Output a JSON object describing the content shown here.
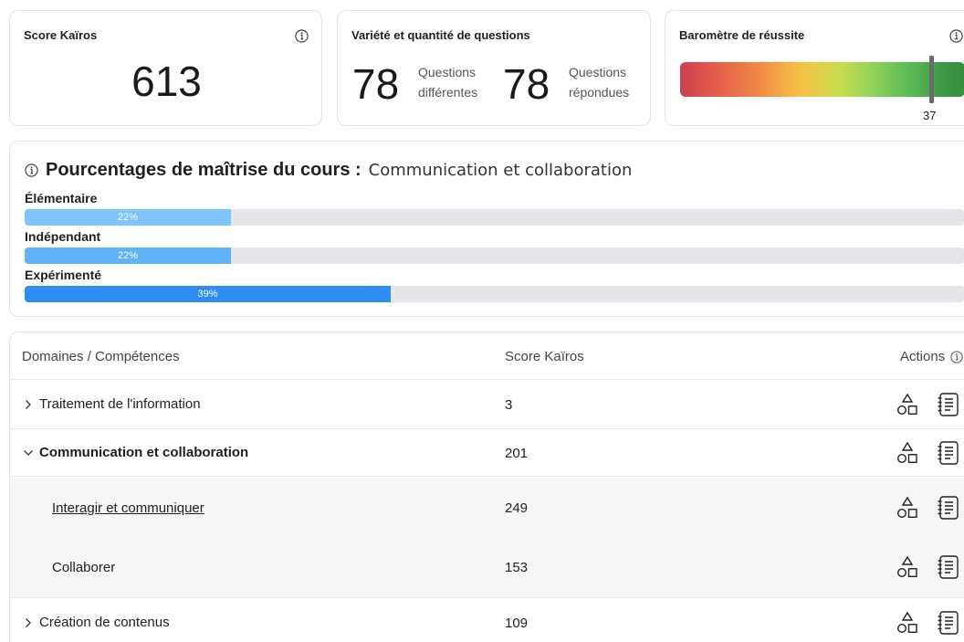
{
  "score_card": {
    "title": "Score Kaïros",
    "value": "613",
    "info_icon": "info-icon"
  },
  "variety_card": {
    "title": "Variété et quantité de questions",
    "different_count": "78",
    "different_label_1": "Questions",
    "different_label_2": "différentes",
    "answered_count": "78",
    "answered_label_1": "Questions",
    "answered_label_2": "répondues"
  },
  "barometer_card": {
    "title": "Baromètre de réussite",
    "value": "37",
    "marker_fraction": 0.88
  },
  "mastery": {
    "title_bold": "Pourcentages de maîtrise du cours :",
    "course_name": "Communication et collaboration",
    "levels": [
      {
        "label": "Élémentaire",
        "percent_label": "22%",
        "fraction": 0.22,
        "color": "#7cc4fb"
      },
      {
        "label": "Indépendant",
        "percent_label": "22%",
        "fraction": 0.22,
        "color": "#5fb3f9"
      },
      {
        "label": "Expérimenté",
        "percent_label": "39%",
        "fraction": 0.39,
        "color": "#2f8cf0"
      }
    ],
    "track_color": "#e4e6ea"
  },
  "table": {
    "headers": {
      "domain": "Domaines / Compétences",
      "score": "Score Kaïros",
      "actions": "Actions"
    },
    "rows": [
      {
        "name": "Traitement de l'information",
        "score": "3",
        "expanded": false,
        "level": 0
      },
      {
        "name": "Communication et collaboration",
        "score": "201",
        "expanded": true,
        "level": 0
      },
      {
        "name": "Interagir et communiquer",
        "score": "249",
        "level": 1,
        "link": true
      },
      {
        "name": "Collaborer",
        "score": "153",
        "level": 1
      },
      {
        "name": "Création de contenus",
        "score": "109",
        "expanded": false,
        "level": 0
      }
    ],
    "action_icons": [
      "shapes-icon",
      "document-list-icon"
    ]
  }
}
